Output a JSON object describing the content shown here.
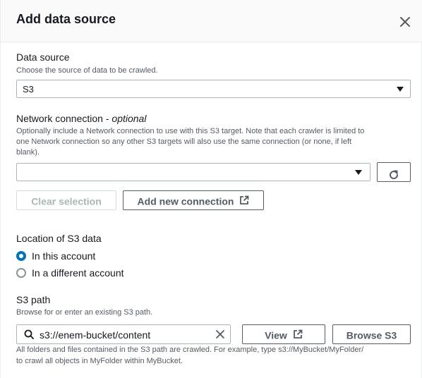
{
  "modal": {
    "title": "Add data source"
  },
  "data_source": {
    "label": "Data source",
    "description": "Choose the source of data to be crawled.",
    "value": "S3"
  },
  "network": {
    "label": "Network connection",
    "label_suffix": "optional",
    "description_line1": "Optionally include a Network connection to use with this S3 target. Note that each crawler is limited to",
    "description_line2": "one Network connection so any other S3 targets will also use the same connection (or none, if left",
    "description_line3": "blank).",
    "value": "",
    "clear_label": "Clear selection",
    "add_label": "Add new connection"
  },
  "location": {
    "label": "Location of S3 data",
    "options": [
      "In this account",
      "In a different account"
    ],
    "selected": "In this account"
  },
  "s3_path": {
    "label": "S3 path",
    "description": "Browse for or enter an existing S3 path.",
    "value": "s3://enem-bucket/content",
    "view_label": "View",
    "browse_label": "Browse S3",
    "help_line1": "All folders and files contained in the S3 path are crawled. For example, type s3://MyBucket/MyFolder/",
    "help_line2": "to crawl all objects in MyFolder within MyBucket."
  },
  "colors": {
    "accent": "#0073bb",
    "text": "#16191f",
    "muted": "#545b64"
  }
}
